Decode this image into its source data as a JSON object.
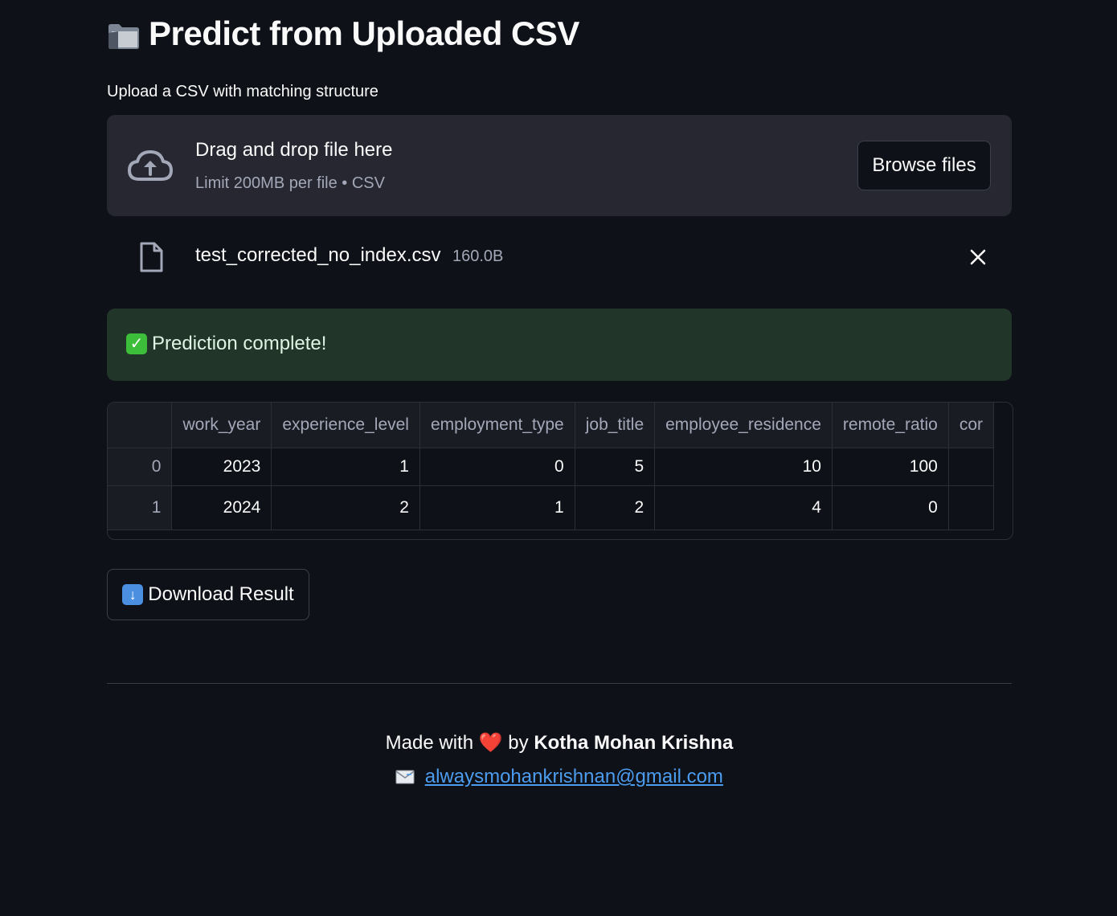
{
  "page": {
    "title": "Predict from Uploaded CSV",
    "title_icon": "folder-icon"
  },
  "uploader": {
    "label": "Upload a CSV with matching structure",
    "drop_title": "Drag and drop file here",
    "drop_subtitle": "Limit 200MB per file • CSV",
    "browse_label": "Browse files",
    "icon": "cloud-upload-icon"
  },
  "uploaded_file": {
    "name": "test_corrected_no_index.csv",
    "size": "160.0B",
    "icon": "file-icon",
    "remove_icon": "close-icon"
  },
  "status": {
    "icon": "check-mark-icon",
    "message": "Prediction complete!",
    "color": "#213529"
  },
  "table": {
    "columns": [
      "work_year",
      "experience_level",
      "employment_type",
      "job_title",
      "employee_residence",
      "remote_ratio",
      "cor"
    ],
    "rows": [
      {
        "index": "0",
        "values": [
          "2023",
          "1",
          "0",
          "5",
          "10",
          "100",
          ""
        ]
      },
      {
        "index": "1",
        "values": [
          "2024",
          "2",
          "1",
          "2",
          "4",
          "0",
          ""
        ]
      }
    ]
  },
  "download": {
    "icon": "down-arrow-icon",
    "label": "Download Result"
  },
  "footer": {
    "made_with": "Made with",
    "heart": "❤️",
    "by": "by",
    "author": "Kotha Mohan Krishna",
    "mail_icon": "envelope-icon",
    "email": "alwaysmohankrishnan@gmail.com",
    "link_color": "#4c9cf0"
  }
}
